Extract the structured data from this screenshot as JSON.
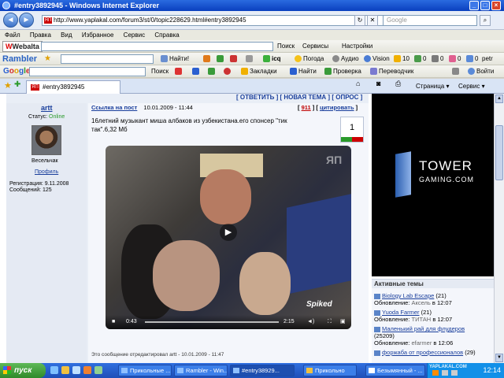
{
  "window": {
    "title": "#entry3892945 - Windows Internet Explorer"
  },
  "address": {
    "url": "http://www.yaplakal.com/forum3/st/0/topic228629.html#entry3892945",
    "search_placeholder": "Google"
  },
  "menu": [
    "Файл",
    "Правка",
    "Вид",
    "Избранное",
    "Сервис",
    "Справка"
  ],
  "webalta_bar": {
    "logo": "Webalta",
    "search_label": "Поиск",
    "services": "Сервисы",
    "settings": "Настройки"
  },
  "rambler_bar": {
    "logo": "Rambler",
    "find": "Найти!",
    "icq": "icq",
    "weather": "Погода",
    "audio": "Аудио",
    "vision": "Vision",
    "count1": "10",
    "count2": "0",
    "count3": "0",
    "count4": "0",
    "count5": "0",
    "user": "petr"
  },
  "google_bar": {
    "logo": "Google",
    "search": "Поиск",
    "bookmarks": "Закладки",
    "find": "Найти",
    "check": "Проверка",
    "translate": "Переводчик",
    "signin": "Войти"
  },
  "tabs": {
    "active": "#entry3892945",
    "page_menu": "Страница",
    "tools_menu": "Сервис"
  },
  "post": {
    "author": "artt",
    "status_label": "Статус:",
    "status_value": "Online",
    "user_title": "Весельчак",
    "profile_link": "Профиль",
    "reg_label": "Регистрация: 9.11.2008",
    "messages_label": "Сообщений: 125",
    "link_label": "Ссылка на пост",
    "date": "10.01.2009 - 11:44",
    "post_number": "911",
    "quote": "цитировать",
    "text": "16летний музыкант миша албаков из узбекистана.его спонсер \"тик так\".6,32 Мб",
    "rating": "1",
    "edited": "Это сообщение отредактировал artt - 10.01.2009 - 11:47"
  },
  "topbar": {
    "reply": "[ ОТВЕТИТЬ ]",
    "new_topic": "[ НОВАЯ ТЕМА ]",
    "poll": "[ ОПРОС ]"
  },
  "video": {
    "time_current": "0:43",
    "time_total": "2:15",
    "logo_text": "Spiked"
  },
  "ad": {
    "line1": "TOWER",
    "line2": "GAMING.COM"
  },
  "active_topics": {
    "header": "Активные темы",
    "items": [
      {
        "title": "Biology Lab Escape",
        "count": "(21)",
        "update_label": "Обновление:",
        "who": "Аксель",
        "time": "в 12:07"
      },
      {
        "title": "Yuoda Farmer",
        "count": "(21)",
        "update_label": "Обновление:",
        "who": "ТИТАН",
        "time": "в 12:07"
      },
      {
        "title": "Маленький рай для флудеров",
        "count": "(25209)",
        "update_label": "Обновление:",
        "who": "efarmer",
        "time": "в 12:06"
      },
      {
        "title": "форжаба от профессионалов",
        "count": "(29)",
        "update_label": "",
        "who": "",
        "time": ""
      }
    ]
  },
  "taskbar": {
    "start": "пуск",
    "tasks": [
      "Прикольные ...",
      "Rambler - Win...",
      "#entry38929...",
      "Прикольно",
      "Безымянный - ..."
    ],
    "clock": "12:14",
    "watermark": "YAPLAKAL.COM"
  },
  "colors": {
    "accent": "#1a3f9c",
    "online": "#2a9a2a",
    "number": "#c00000"
  }
}
